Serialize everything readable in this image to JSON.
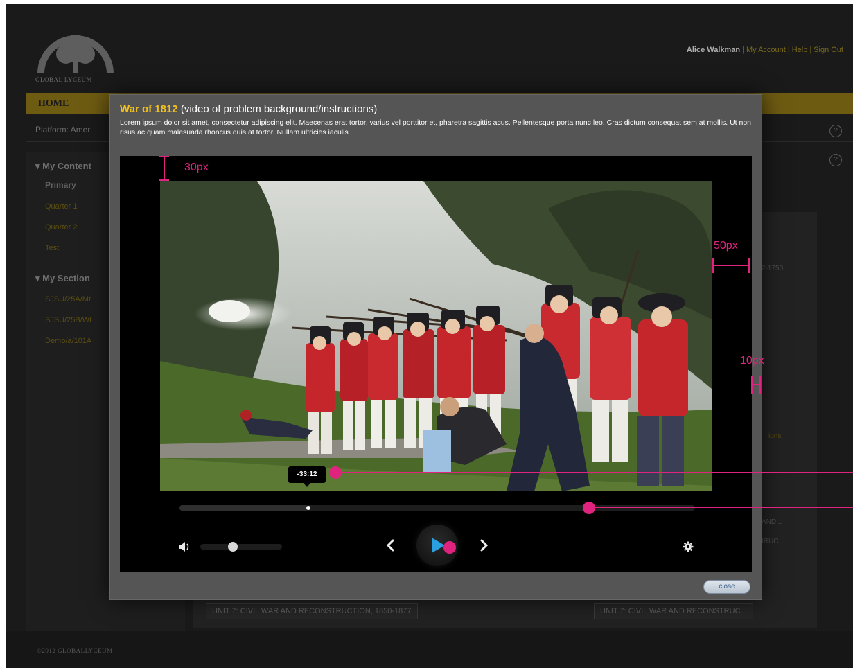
{
  "brand": {
    "logo_text": "GLOBAL LYCEUM"
  },
  "user_nav": {
    "name": "Alice Walkman",
    "links": [
      "My Account",
      "Help",
      "Sign Out"
    ]
  },
  "nav": {
    "home": "HOME"
  },
  "platform": {
    "label": "Platform: Amer"
  },
  "sidebar": {
    "my_content": "My Content",
    "primary": "Primary",
    "content_links": [
      "Quarter 1",
      "Quarter 2",
      "Test"
    ],
    "my_sections": "My Section",
    "section_links": [
      "SJSU/25A/Mt",
      "SJSU/25B/Wt",
      "Demo/a/101A"
    ]
  },
  "background": {
    "units_left": "UNIT 7: CIVIL WAR AND RECONSTRUCTION, 1850-1877",
    "units_right": "UNIT 7: CIVIL WAR AND RECONSTRUC...",
    "frag_1": "2-1750",
    "frag_2": "ions",
    "frag_3": "AND...",
    "frag_4": "IRUC..."
  },
  "footer": {
    "text": "©2012 GLOBALLYCEUM"
  },
  "modal": {
    "title": "War of 1812",
    "subtitle": " (video of problem background/instructions)",
    "description": "Lorem ipsum dolor sit amet, consectetur adipiscing elit. Maecenas erat tortor, varius vel porttitor et, pharetra sagittis  acus. Pellentesque porta nunc leo. Cras dictum consequat sem at mollis. Ut non risus ac quam malesuada rhoncus quis at tortor. Nullam ultricies iaculis",
    "close_label": "close"
  },
  "player": {
    "time_remaining": "-33:12",
    "progress_fraction": 0.25,
    "volume_fraction": 0.4,
    "icons": [
      "volume-icon",
      "previous-icon",
      "play-icon",
      "next-icon",
      "gear-icon"
    ]
  },
  "annotations": {
    "top_gap": "30px",
    "side_gap": "50px",
    "edge_gap": "10px"
  },
  "colors": {
    "accent": "#f2c11e",
    "annotation": "#e0237f",
    "play": "#2aa0e0"
  }
}
